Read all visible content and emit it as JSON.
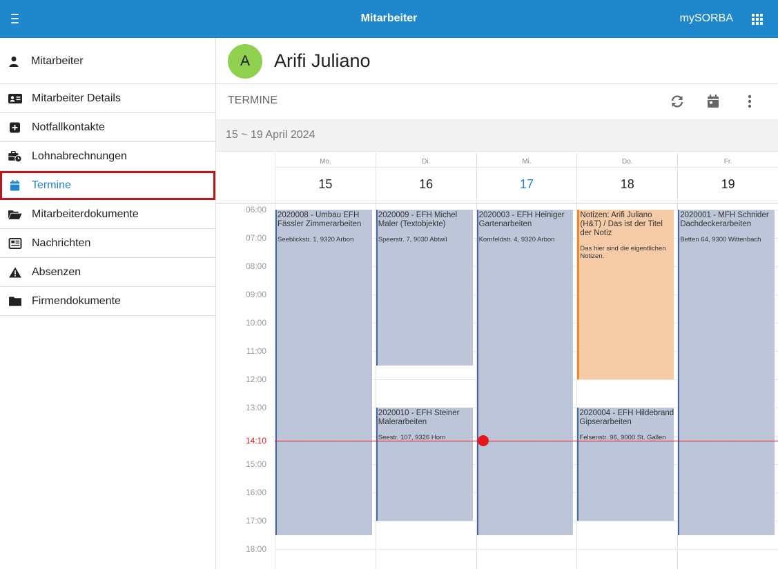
{
  "topbar": {
    "title": "Mitarbeiter",
    "brand": "mySORBA"
  },
  "sidebar": {
    "header": "Mitarbeiter",
    "items": [
      {
        "label": "Mitarbeiter Details",
        "icon": "id-card-icon"
      },
      {
        "label": "Notfallkontakte",
        "icon": "plus-square-icon"
      },
      {
        "label": "Lohnabrechnungen",
        "icon": "briefcase-clock-icon"
      },
      {
        "label": "Termine",
        "icon": "calendar-icon",
        "active": true
      },
      {
        "label": "Mitarbeiterdokumente",
        "icon": "folder-open-icon"
      },
      {
        "label": "Nachrichten",
        "icon": "newspaper-icon"
      },
      {
        "label": "Absenzen",
        "icon": "warning-icon"
      },
      {
        "label": "Firmendokumente",
        "icon": "folder-icon"
      }
    ]
  },
  "employee": {
    "initial": "A",
    "name": "Arifi Juliano",
    "avatar_color": "#8fd14f"
  },
  "section": {
    "title": "TERMINE"
  },
  "calendar": {
    "range": "15 ~ 19 April 2024",
    "days": [
      {
        "weekday": "Mo.",
        "day": "15"
      },
      {
        "weekday": "Di.",
        "day": "16"
      },
      {
        "weekday": "Mi.",
        "day": "17",
        "today": true
      },
      {
        "weekday": "Do.",
        "day": "18"
      },
      {
        "weekday": "Fr.",
        "day": "19"
      }
    ],
    "hours": [
      "06:00",
      "07:00",
      "08:00",
      "09:00",
      "10:00",
      "11:00",
      "12:00",
      "13:00",
      "14:00",
      "15:00",
      "16:00",
      "17:00",
      "18:00"
    ],
    "now": "14:10",
    "events": [
      {
        "day": 0,
        "start": "06:00",
        "end": "17:30",
        "title": "2020008 - Umbau EFH Fässler Zimmerarbeiten",
        "address": "Seeblickstr. 1, 9320 Arbon"
      },
      {
        "day": 1,
        "start": "06:00",
        "end": "11:30",
        "title": "2020009 - EFH Michel Maler (Textobjekte)",
        "address": "Speerstr. 7, 9030 Abtwil"
      },
      {
        "day": 1,
        "start": "13:00",
        "end": "17:00",
        "title": "2020010 - EFH Steiner Malerarbeiten",
        "address": "Seestr. 107, 9326 Horn"
      },
      {
        "day": 2,
        "start": "06:00",
        "end": "17:30",
        "title": "2020003 - EFH Heiniger Gartenarbeiten",
        "address": "Kornfeldstr. 4, 9320 Arbon"
      },
      {
        "day": 3,
        "start": "06:00",
        "end": "12:00",
        "title": "Notizen: Arifi Juliano (H&T) / Das ist der Titel der Notiz",
        "address": "Das hier sind die eigentlichen Notizen.",
        "note": true
      },
      {
        "day": 3,
        "start": "13:00",
        "end": "17:00",
        "title": "2020004 - EFH Hildebrand Gipserarbeiten",
        "address": "Felsenstr. 96, 9000 St. Gallen"
      },
      {
        "day": 4,
        "start": "06:00",
        "end": "17:30",
        "title": "2020001 - MFH Schnider Dachdeckerarbeiten",
        "address": "Betten 64, 9300 Wittenbach"
      }
    ]
  },
  "colors": {
    "brand": "#1f88cc",
    "event": "#bcc6d8",
    "note": "#f6cba7",
    "now": "#e5161b",
    "active_border": "#b8171c"
  }
}
